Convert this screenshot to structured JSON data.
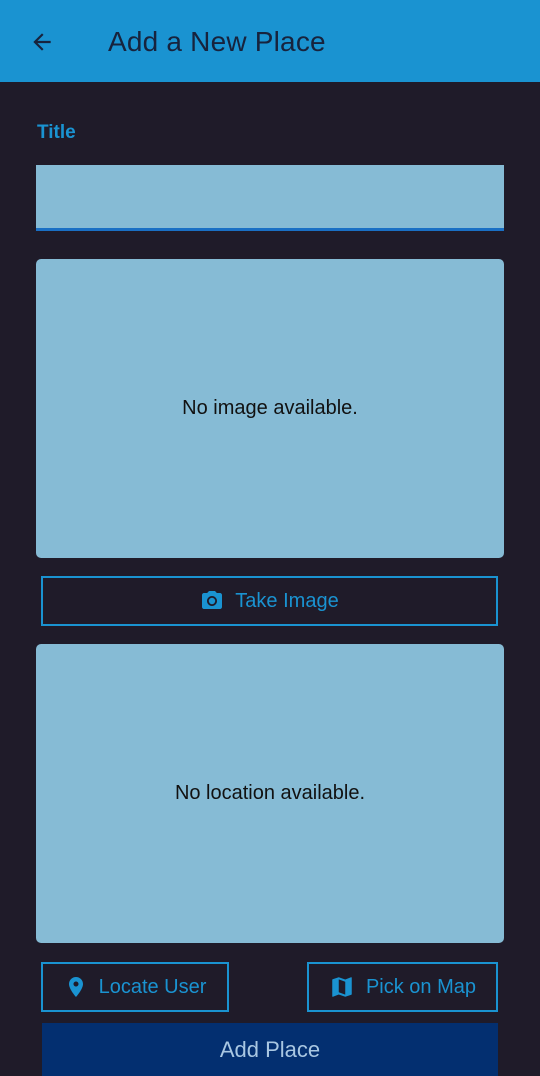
{
  "appbar": {
    "title": "Add a New Place",
    "back_icon": "arrow-back-icon"
  },
  "form": {
    "title_label": "Title",
    "title_value": "",
    "image_placeholder": "No image available.",
    "take_image_label": "Take Image",
    "take_image_icon": "camera-icon",
    "location_placeholder": "No location available.",
    "locate_user_label": "Locate User",
    "locate_user_icon": "location-pin-icon",
    "pick_on_map_label": "Pick on Map",
    "pick_on_map_icon": "map-icon",
    "add_place_label": "Add Place"
  },
  "colors": {
    "appbar": "#1a93d1",
    "background": "#1f1b29",
    "accent": "#1a93d1",
    "panel": "#86bbd5",
    "primary_button": "#032f70"
  }
}
